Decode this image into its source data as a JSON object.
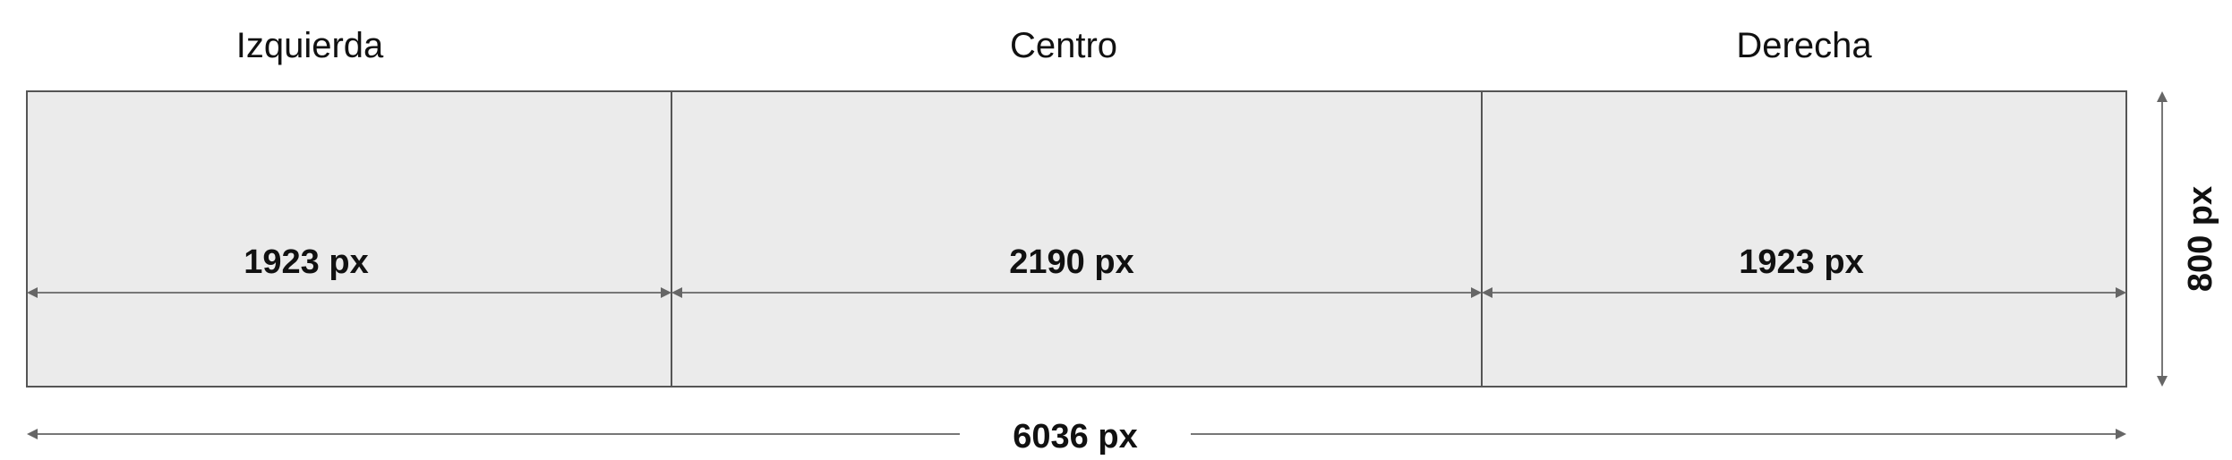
{
  "sections": [
    {
      "title": "Izquierda",
      "width": 1923,
      "width_label": "1923 px"
    },
    {
      "title": "Centro",
      "width": 2190,
      "width_label": "2190 px"
    },
    {
      "title": "Derecha",
      "width": 1923,
      "width_label": "1923 px"
    }
  ],
  "total": {
    "width": 6036,
    "label": "6036 px"
  },
  "height": {
    "value": 800,
    "label": "800 px"
  },
  "colors": {
    "panel_fill": "#ebebeb",
    "panel_stroke": "#555555",
    "dimension_line": "#777777",
    "text": "#111111"
  }
}
